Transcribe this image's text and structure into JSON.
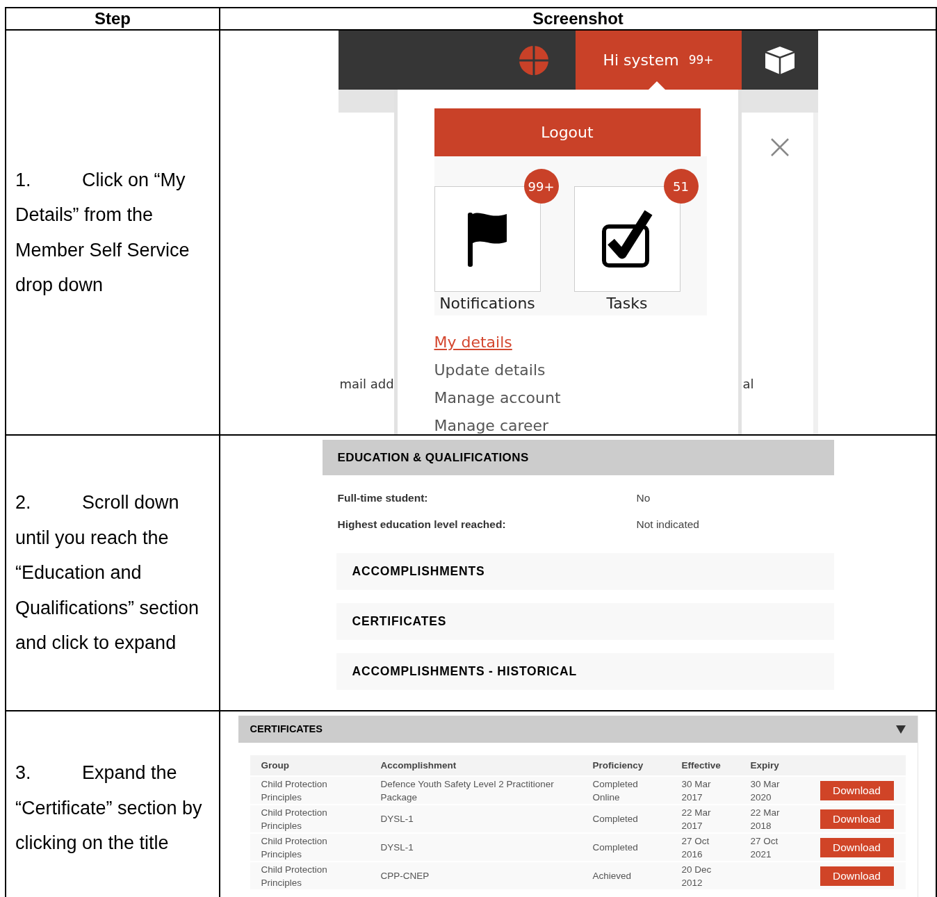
{
  "table": {
    "columns": [
      "Step",
      "Screenshot"
    ],
    "rows": [
      {
        "number": "1.",
        "instruction": "Click on “My Details” from the Member Self Service drop down",
        "screenshot": {
          "kind": "user_menu",
          "user_label": "Hi system",
          "user_badge": "99+",
          "logout": "Logout",
          "tiles": [
            {
              "kind": "flag",
              "label": "Notifications",
              "badge": "99+"
            },
            {
              "kind": "task",
              "label": "Tasks",
              "badge": "51"
            }
          ],
          "links": [
            {
              "label": "My details",
              "selected": true
            },
            {
              "label": "Update details",
              "selected": false
            },
            {
              "label": "Manage account",
              "selected": false
            },
            {
              "label": "Manage career",
              "selected": false
            }
          ],
          "background_texts": [
            "mail add",
            "al"
          ]
        }
      },
      {
        "number": "2.",
        "instruction": "Scroll down until you reach the “Education and Qualifications” section and click to expand",
        "screenshot": {
          "kind": "education",
          "title": "EDUCATION & QUALIFICATIONS",
          "fields": [
            {
              "label": "Full-time student:",
              "value": "No"
            },
            {
              "label": "Highest education level reached:",
              "value": "Not indicated"
            }
          ],
          "sections": [
            "ACCOMPLISHMENTS",
            "CERTIFICATES",
            "ACCOMPLISHMENTS - HISTORICAL"
          ]
        }
      },
      {
        "number": "3.",
        "instruction": "Expand the “Certificate” section by clicking on the title",
        "screenshot": {
          "kind": "certificates",
          "title": "CERTIFICATES",
          "expanded": true,
          "columns": [
            "Group",
            "Accomplishment",
            "Proficiency",
            "Effective",
            "Expiry"
          ],
          "rows": [
            {
              "group": "Child Protection Principles",
              "accomplishment": "Defence Youth Safety Level 2 Practitioner Package",
              "proficiency": "Completed Online",
              "effective": "30 Mar 2017",
              "expiry": "30 Mar 2020",
              "action": "Download"
            },
            {
              "group": "Child Protection Principles",
              "accomplishment": "DYSL-1",
              "proficiency": "Completed",
              "effective": "22 Mar 2017",
              "expiry": "22 Mar 2018",
              "action": "Download"
            },
            {
              "group": "Child Protection Principles",
              "accomplishment": "DYSL-1",
              "proficiency": "Completed",
              "effective": "27 Oct 2016",
              "expiry": "27 Oct 2021",
              "action": "Download"
            },
            {
              "group": "Child Protection Principles",
              "accomplishment": "CPP-CNEP",
              "proficiency": "Achieved",
              "effective": "20 Dec 2012",
              "action": "Download"
            }
          ]
        }
      }
    ]
  }
}
